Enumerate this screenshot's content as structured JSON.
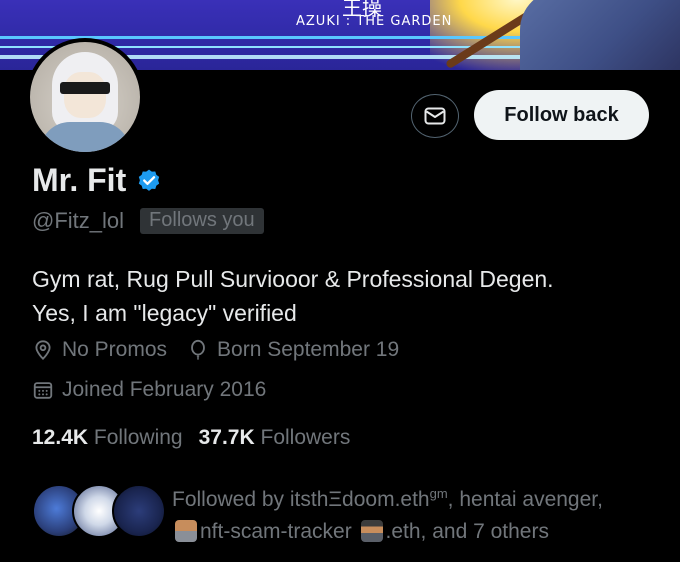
{
  "banner": {
    "kanji": "王操",
    "title": "AZUKI : THE GARDEN"
  },
  "actions": {
    "message_icon": "envelope-icon",
    "follow_back_label": "Follow back"
  },
  "profile": {
    "name": "Mr. Fit",
    "verified_icon": "verified-badge-icon",
    "verified_color": "#1d9bf0",
    "handle": "@Fitz_lol",
    "follows_you": "Follows you",
    "bio_line1": "Gym rat, Rug Pull Surviooor & Professional Degen.",
    "bio_line2": "Yes, I am \"legacy\" verified",
    "location": "No Promos",
    "birthday": "Born September 19",
    "joined": "Joined February 2016"
  },
  "stats": {
    "following_count": "12.4K",
    "following_label": "Following",
    "followers_count": "37.7K",
    "followers_label": "Followers"
  },
  "followed_by": {
    "prefix": "Followed by itsthΞdoom.eth",
    "sup": "gm",
    "part2": ", hentai avenger,",
    "part3": "nft-scam-tracker",
    "part4": ".eth, and 7 others"
  }
}
